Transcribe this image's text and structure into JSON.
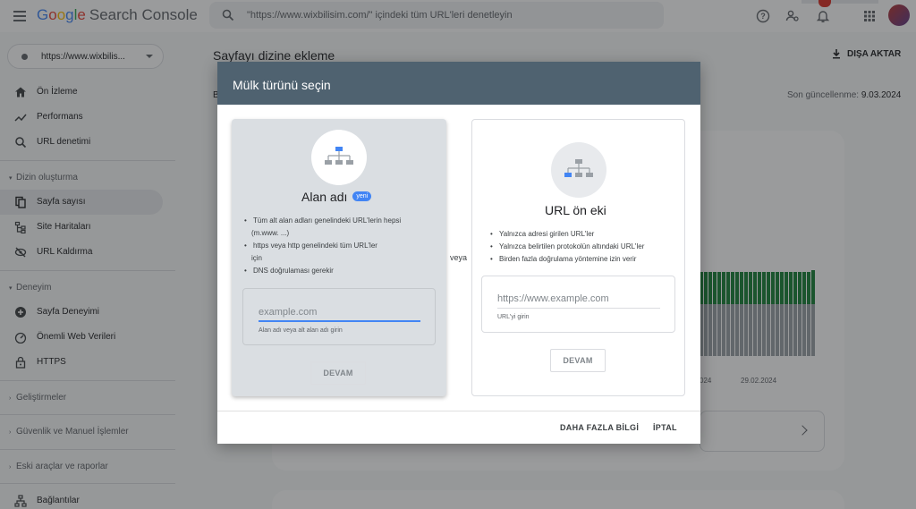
{
  "header": {
    "logo_google": [
      "G",
      "o",
      "o",
      "g",
      "l",
      "e"
    ],
    "product": "Search Console",
    "search_text": "\"https://www.wixbilisim.com/\" içindeki tüm URL'leri denetleyin",
    "icons": [
      "help-icon",
      "manage-users-icon",
      "notifications-icon",
      "apps-icon",
      "account-avatar"
    ]
  },
  "sidebar": {
    "property": "https://www.wixbilis...",
    "items_top": [
      {
        "label": "Ön İzleme",
        "icon": "home-icon"
      },
      {
        "label": "Performans",
        "icon": "trending-icon"
      },
      {
        "label": "URL denetimi",
        "icon": "search-icon"
      }
    ],
    "section_indexing": "Dizin oluşturma",
    "items_indexing": [
      {
        "label": "Sayfa sayısı",
        "icon": "pages-icon",
        "active": true
      },
      {
        "label": "Site Haritaları",
        "icon": "sitemap-icon"
      },
      {
        "label": "URL Kaldırma",
        "icon": "removal-icon"
      }
    ],
    "section_experience": "Deneyim",
    "items_experience": [
      {
        "label": "Sayfa Deneyimi",
        "icon": "page-experience-icon"
      },
      {
        "label": "Önemli Web Verileri",
        "icon": "speed-icon"
      },
      {
        "label": "HTTPS",
        "icon": "lock-icon"
      }
    ],
    "section_enhancements": "Geliştirmeler",
    "section_security": "Güvenlik ve Manuel İşlemler",
    "section_legacy": "Eski araçlar ve raporlar",
    "item_links": "Bağlantılar"
  },
  "main": {
    "title": "Sayfayı dizine ekleme",
    "export": "DIŞA AKTAR",
    "updated_label": "Son güncellenme:",
    "updated_value": "9.03.2024",
    "partial_b": "B",
    "x_ticks": [
      "024",
      "29.02.2024"
    ]
  },
  "dialog": {
    "title": "Mülk türünü seçin",
    "or": "veya",
    "domain": {
      "title": "Alan adı",
      "badge": "yeni",
      "bullets": [
        "Tüm alt alan adları genelindeki URL'lerin hepsi",
        "(m.www. ...)",
        "https veya http genelindeki tüm URL'ler",
        "için",
        "DNS doğrulaması gerekir"
      ],
      "placeholder": "example.com",
      "help": "Alan adı veya alt alan adı girin",
      "button": "DEVAM"
    },
    "url_prefix": {
      "title": "URL ön eki",
      "bullets": [
        "Yalnızca adresi girilen URL'ler",
        "Yalnızca belirtilen protokolün altındaki URL'ler",
        "Birden fazla doğrulama yöntemine izin verir"
      ],
      "placeholder": "https://www.example.com",
      "help": "URL'yi girin",
      "button": "DEVAM"
    },
    "learn_more": "DAHA FAZLA BİLGİ",
    "cancel": "İPTAL"
  },
  "colors": {
    "dialog_header": "#4f6270",
    "accent_blue": "#4285f4",
    "bar_green": "#188038",
    "bar_gray": "#9aa0a6"
  }
}
